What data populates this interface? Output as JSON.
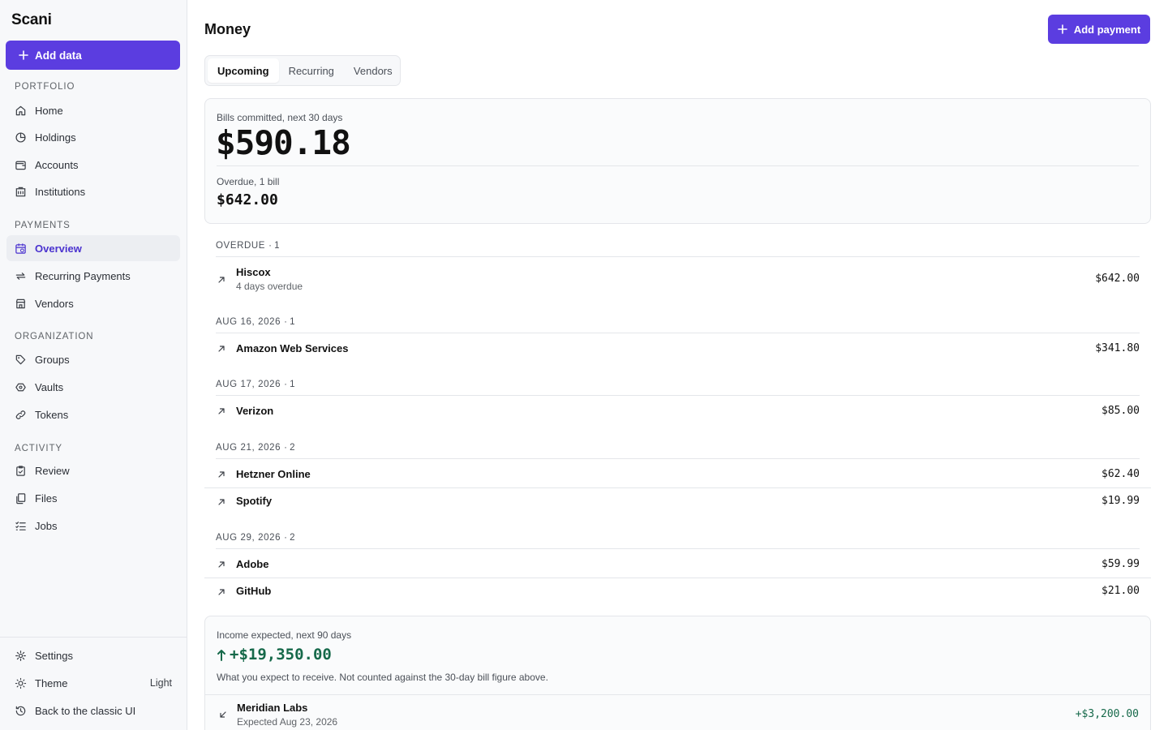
{
  "app": {
    "brand": "Scani"
  },
  "sidebar": {
    "add_data_label": "Add data",
    "sections": [
      {
        "label": "PORTFOLIO",
        "items": [
          {
            "label": "Home",
            "icon": "home-icon"
          },
          {
            "label": "Holdings",
            "icon": "pie-chart-icon"
          },
          {
            "label": "Accounts",
            "icon": "wallet-icon"
          },
          {
            "label": "Institutions",
            "icon": "building-icon"
          }
        ]
      },
      {
        "label": "PAYMENTS",
        "items": [
          {
            "label": "Overview",
            "icon": "calendar-icon",
            "active": true
          },
          {
            "label": "Recurring Payments",
            "icon": "repeat-icon"
          },
          {
            "label": "Vendors",
            "icon": "store-icon"
          }
        ]
      },
      {
        "label": "ORGANIZATION",
        "items": [
          {
            "label": "Groups",
            "icon": "tag-icon"
          },
          {
            "label": "Vaults",
            "icon": "vault-icon"
          },
          {
            "label": "Tokens",
            "icon": "link-icon"
          }
        ]
      },
      {
        "label": "ACTIVITY",
        "items": [
          {
            "label": "Review",
            "icon": "clipboard-icon"
          },
          {
            "label": "Files",
            "icon": "files-icon"
          },
          {
            "label": "Jobs",
            "icon": "list-check-icon"
          }
        ]
      }
    ],
    "footer": {
      "settings": "Settings",
      "theme": "Theme",
      "theme_value": "Light",
      "classic": "Back to the classic UI"
    }
  },
  "header": {
    "title": "Money",
    "add_payment_label": "Add payment"
  },
  "tabs": [
    {
      "label": "Upcoming",
      "active": true
    },
    {
      "label": "Recurring"
    },
    {
      "label": "Vendors"
    }
  ],
  "summary": {
    "committed_label": "Bills committed, next 30 days",
    "committed_value": "$590.18",
    "overdue_label": "Overdue, 1 bill",
    "overdue_value": "$642.00"
  },
  "groups": [
    {
      "title": "OVERDUE",
      "count": "· 1",
      "items": [
        {
          "name": "Hiscox",
          "sub": "4 days overdue",
          "amount": "$642.00"
        }
      ]
    },
    {
      "title": "AUG 16, 2026",
      "count": "· 1",
      "items": [
        {
          "name": "Amazon Web Services",
          "amount": "$341.80"
        }
      ]
    },
    {
      "title": "AUG 17, 2026",
      "count": "· 1",
      "items": [
        {
          "name": "Verizon",
          "amount": "$85.00"
        }
      ]
    },
    {
      "title": "AUG 21, 2026",
      "count": "· 2",
      "items": [
        {
          "name": "Hetzner Online",
          "amount": "$62.40"
        },
        {
          "name": "Spotify",
          "amount": "$19.99"
        }
      ]
    },
    {
      "title": "AUG 29, 2026",
      "count": "· 2",
      "items": [
        {
          "name": "Adobe",
          "amount": "$59.99"
        },
        {
          "name": "GitHub",
          "amount": "$21.00"
        }
      ]
    }
  ],
  "income": {
    "label": "Income expected, next 90 days",
    "value": "+$19,350.00",
    "note": "What you expect to receive. Not counted against the 30-day bill figure above.",
    "items": [
      {
        "name": "Meridian Labs",
        "sub": "Expected Aug 23, 2026",
        "amount": "+$3,200.00"
      }
    ]
  },
  "colors": {
    "accent": "#5b3de0",
    "income": "#16694a",
    "active_nav": "#4a32cf"
  }
}
